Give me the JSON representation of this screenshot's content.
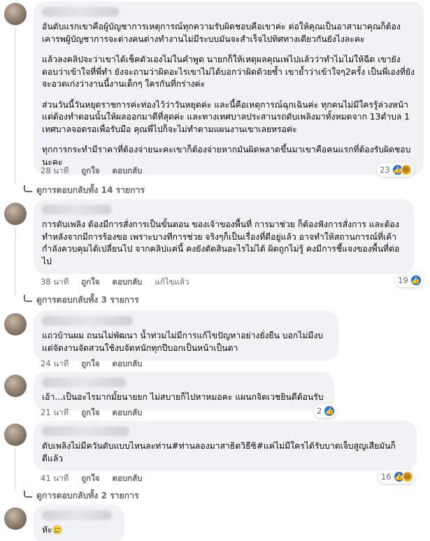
{
  "comments": [
    {
      "paragraphs": [
        "อันดับแรกเขาคือผู้บัญชาการเหตุการณ์ทุกความรับผิดชอบคือเขาค่ะ ต่อให้คุณเป็นอาสามาคุณก็ต้องเคารพผู้บัญชาการจะต่างคนต่างทำงานไม่มีระบบมันจะสำเร็จไปทิศทางเดียวกันยังไงละคะ",
        "แล้วลงคลิปจะว่าเขาได้เช็คตัวเองไม่ในคำพูด นายกก็ให้เหตุผลคุณเพ่ไปแล้วว่าทำไมไม่ให้ฉีด เขายังตอบว่าเข้าใจที่พี่ทำ ยังจะถามว่าผิดอะไรเขาไม่ได้บอกว่าผิดด้วยซ้ำ เขาย้ำว่าเข้าใจๆ2ครั้ง เป็นพี่เองที่ยังจะอวดเก่งว่างานนี้งานเด็กๆ ใครกันที่กร่างค่ะ",
        "ส่วนวันนี้วันหยุดราชการค่ะท่องไว้ว่าวันหยุดค่ะ และนี้คือเหตุการณ์ฉุกเฉินค่ะ ทุกคนไม่มีใครรู้ล่วงหน้าแต่ต้องทำตอนนั้นให้ผลออกมาดีที่สุดค่ะ และทางเทศบาลประสานรถดับเพลิงมาทั้งหมดจาก 13ตำบล 1 เทศบาลจอดรอเพื่อรับมือ คุณพี่ไปก็จะไม่ทำตามแผนงานเขาเลยหรอค่ะ",
        "ทุกการกระทำมีราคาที่ต้องจ่ายนะคะเขาก็ต้องจ่ายหากมันผิดพลาดขึ้นมาเขาคือคนแรกที่ต้องรับผิดชอบนะคะ"
      ],
      "time": "28 นาที",
      "like": "ถูกใจ",
      "reply": "ตอบกลับ",
      "reaction_count": "23",
      "replies_text": "ดูการตอบกลับทั้ง 14 รายการ"
    },
    {
      "paragraphs": [
        "การดับเพลิง ต้องมีการสั่งการเป็นขั้นตอน ของเจ้าของพื้นที่ การมาช่วย ก็ต้องฟังการสั่งการ และต้องทำหลังจากมีการร้องขอ เพราะบางทีการช่วย จริงๆก็เป็นเรื่องที่ดีอยู่แล้ว อาจทำให้สถานการณ์ที่เค้ากำลังควบคุมได้เปลี่ยนไป จากคลิปแค่นี้ คงยังตัดสินอะไรไม่ได้ ผิดถูกไม่รู้ คงมีการชี้แจงของพื้นที่ต่อไป"
      ],
      "time": "38 นาที",
      "like": "ถูกใจ",
      "reply": "ตอบกลับ",
      "edited": "แก้ไขแล้ว",
      "reaction_count": "19",
      "replies_text": "ดูการตอบกลับทั้ง 3 รายการ"
    },
    {
      "paragraphs": [
        "แถวบ้านผม ถนนไม่พัฒนา น้ำท่วมไม่มีการแก้ไขปัญหาอย่างยั่งยืน บอกไม่มีงบ แต่จัดงานจัดสวนใช้งบจัดหนักทุกปีบอกเป็นหน้าเป็นตา"
      ],
      "time": "24 นาที",
      "like": "ถูกใจ",
      "reply": "ตอบกลับ"
    },
    {
      "paragraphs": [
        "เอ้า...เป็นอะไรมากมั้ยนายยก ไม่สบายก็ไปหาหมอคะ แผนกจิตเวชยินดีต้อนรับ"
      ],
      "time": "21 นาที",
      "like": "ถูกใจ",
      "reply": "ตอบกลับ",
      "reaction_count": "2"
    },
    {
      "paragraphs": [
        "ดับเพลิงไม่มีควันดับแบบไหนละท่าน#ท่านลองมาสาธิตวิธีซิ#แค่ไม่มีใครได้รับบาดเจ็บสูญเสียมันก็ดีแล้ว"
      ],
      "time": "41 นาที",
      "like": "ถูกใจ",
      "reply": "ตอบกลับ",
      "reaction_count": "16",
      "replies_text": "ดูการตอบกลับทั้ง 2 รายการ"
    },
    {
      "paragraphs": [
        "หัะ🥲"
      ]
    }
  ],
  "icons": {
    "like": "like-icon",
    "haha": "haha-icon"
  },
  "colors": {
    "bubble": "#f0f2f5",
    "meta": "#65676b",
    "like": "#1b74e4",
    "haha": "#f7b125"
  }
}
